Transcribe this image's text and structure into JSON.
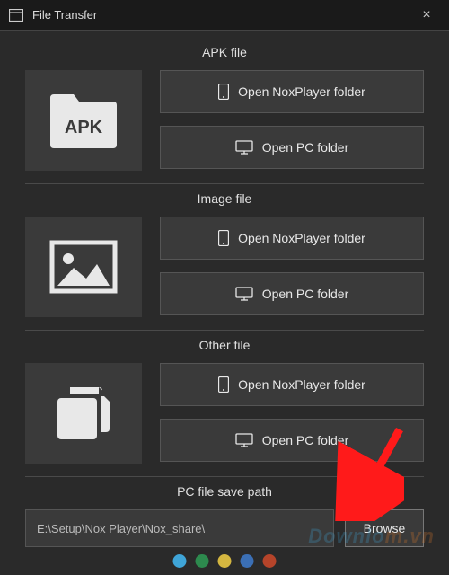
{
  "window": {
    "title": "File Transfer",
    "close_label": "×"
  },
  "sections": {
    "apk": {
      "title": "APK file",
      "open_nox": "Open NoxPlayer folder",
      "open_pc": "Open PC folder"
    },
    "image": {
      "title": "Image file",
      "open_nox": "Open NoxPlayer folder",
      "open_pc": "Open PC folder"
    },
    "other": {
      "title": "Other file",
      "open_nox": "Open NoxPlayer folder",
      "open_pc": "Open PC folder"
    }
  },
  "save_path": {
    "label": "PC file save path",
    "value": "E:\\Setup\\Nox Player\\Nox_share\\",
    "browse": "Browse"
  },
  "watermark": {
    "part1": "Downlo",
    "part2": "m.vn",
    "dot_colors": [
      "#3fa5d8",
      "#2d8a4e",
      "#d4b640",
      "#3b6fb5",
      "#b5442a"
    ]
  }
}
